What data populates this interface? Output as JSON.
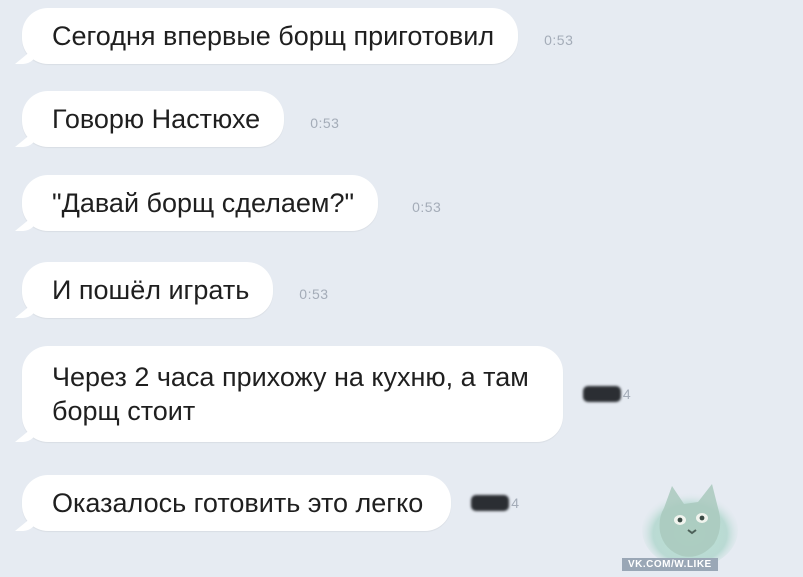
{
  "messages": [
    {
      "text": "Сегодня впервые борщ приготовил",
      "time": "0:53"
    },
    {
      "text": "Говорю Настюхе",
      "time": "0:53"
    },
    {
      "text": "\"Давай борщ сделаем?\"",
      "time": "0:53"
    },
    {
      "text": "И пошёл играть",
      "time": "0:53"
    },
    {
      "text": "Через 2 часа прихожу на кухню, а там\nборщ стоит",
      "time_partial": "4"
    },
    {
      "text": "Оказалось готовить это легко",
      "time_partial": "4"
    }
  ],
  "watermark": "VK.COM/W.LIKE",
  "colors": {
    "background": "#e6ebf2",
    "bubble": "#ffffff",
    "time": "#a4acb8"
  },
  "sticker_icon": "cat-sticker-icon"
}
